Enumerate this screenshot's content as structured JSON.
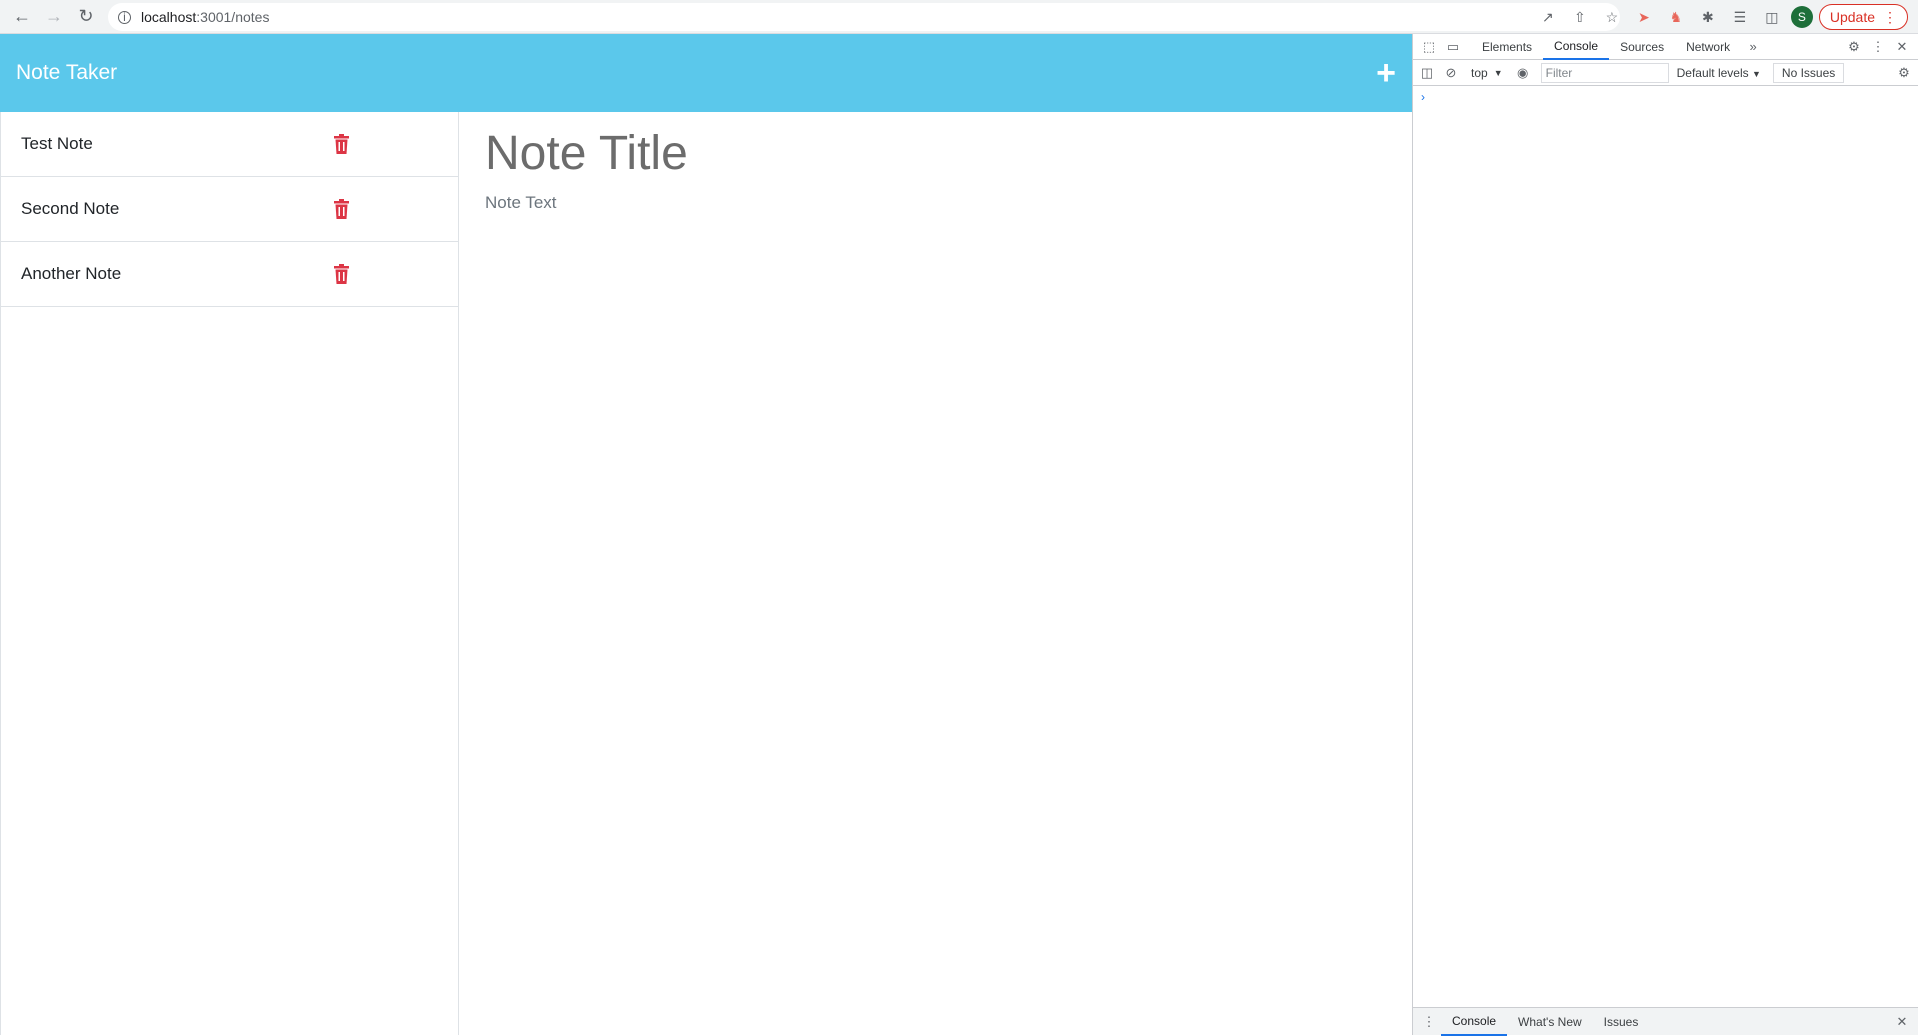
{
  "browser": {
    "url_host": "localhost",
    "url_path": ":3001/notes",
    "profile_initial": "S",
    "update_label": "Update"
  },
  "app": {
    "title": "Note Taker",
    "add_icon": "+",
    "notes": [
      {
        "label": "Test Note"
      },
      {
        "label": "Second Note"
      },
      {
        "label": "Another Note"
      }
    ],
    "editor": {
      "title_placeholder": "Note Title",
      "text_placeholder": "Note Text"
    },
    "colors": {
      "header": "#5bc8eb",
      "delete": "#dc3545"
    }
  },
  "devtools": {
    "tabs": [
      "Elements",
      "Console",
      "Sources",
      "Network"
    ],
    "active_tab": "Console",
    "context": "top",
    "filter_placeholder": "Filter",
    "levels": "Default levels",
    "issues": "No Issues",
    "drawer_tabs": [
      "Console",
      "What's New",
      "Issues"
    ]
  }
}
